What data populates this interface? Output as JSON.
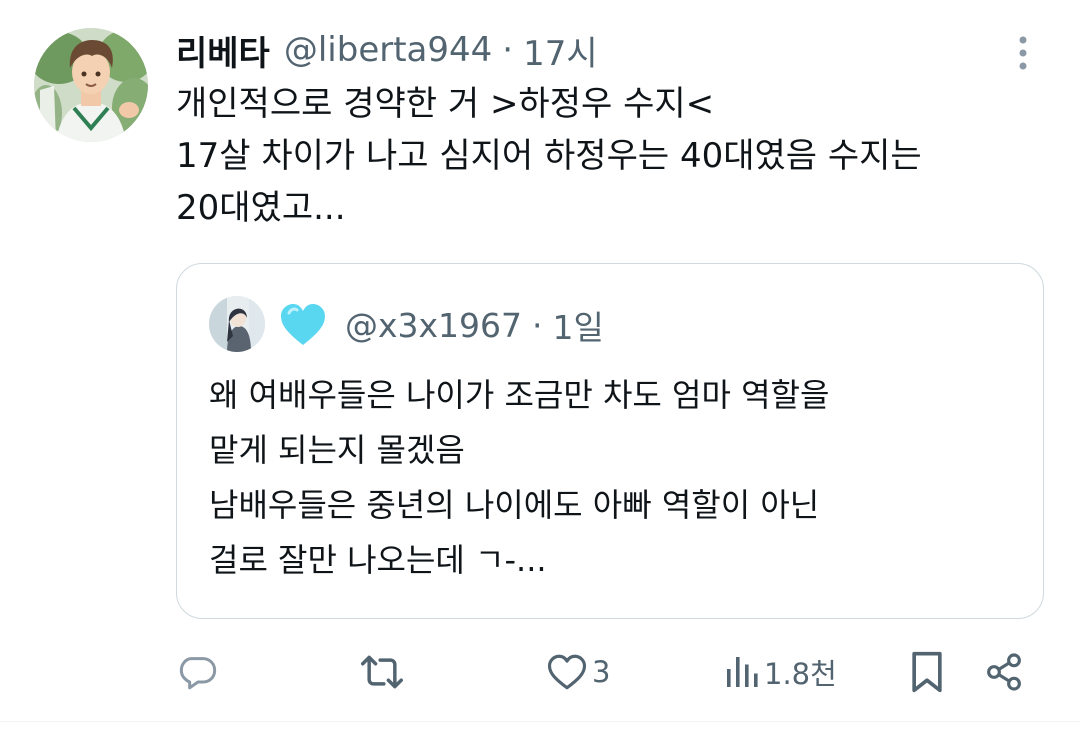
{
  "tweet": {
    "display_name": "리베타",
    "handle": "@liberta944",
    "separator": "·",
    "timestamp": "17시",
    "text": "개인적으로 경약한 거 >하정우 수지<\n17살 차이가 나고 심지어 하정우는 40대였음 수지는\n20대였고..."
  },
  "quote": {
    "emoji": "blue-heart",
    "handle": "@x3x1967",
    "separator": "·",
    "timestamp": "1일",
    "text": "왜 여배우들은 나이가 조금만 차도 엄마 역할을\n맡게 되는지 몰겠음\n남배우들은 중년의 나이에도 아빠 역할이 아닌\n걸로 잘만 나오는데 ㄱ-..."
  },
  "actions": {
    "reply_icon": "reply-icon",
    "repost_icon": "repost-icon",
    "like_icon": "heart-icon",
    "like_count": "3",
    "views_icon": "views-icon",
    "views_count": "1.8천",
    "bookmark_icon": "bookmark-icon",
    "share_icon": "share-icon"
  },
  "colors": {
    "text_primary": "#0f1419",
    "text_secondary": "#536471",
    "border": "#cfd9de",
    "heart_emoji": "#5ad7f0"
  }
}
